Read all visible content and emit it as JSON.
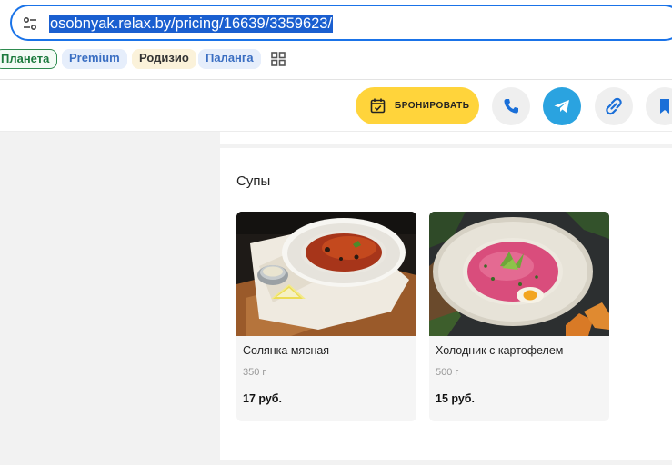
{
  "browser": {
    "url": "osobnyak.relax.by/pricing/16639/3359623/",
    "bookmarks": [
      {
        "label": "Планета"
      },
      {
        "label": "Premium"
      },
      {
        "label": "Родизио"
      },
      {
        "label": "Паланга"
      }
    ],
    "icons": {
      "site_settings": "tune-icon",
      "apps": "apps-grid-icon"
    },
    "accent_color": "#1a73e8"
  },
  "header": {
    "book_label": "БРОНИРОВАТЬ",
    "book_color": "#ffd43b",
    "icons": [
      "calendar-check-icon",
      "phone-icon",
      "telegram-icon",
      "link-icon",
      "bookmark-icon"
    ]
  },
  "menu": {
    "section_title": "Супы",
    "items": [
      {
        "name": "Солянка мясная",
        "weight": "350 г",
        "price": "17 руб.",
        "image": "solyanka-soup-photo"
      },
      {
        "name": "Холодник с картофелем",
        "weight": "500 г",
        "price": "15 руб.",
        "image": "kholodnik-soup-photo"
      }
    ]
  }
}
